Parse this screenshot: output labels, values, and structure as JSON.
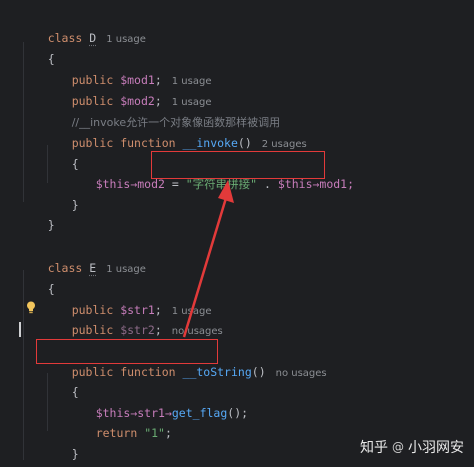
{
  "code": {
    "class_d": {
      "keyword": "class",
      "name": "D",
      "usage_hint": "1 usage",
      "open_brace": "{",
      "close_brace": "}",
      "mod1": {
        "keyword": "public",
        "var": "$mod1",
        "semi": ";",
        "hint": "1 usage"
      },
      "mod2": {
        "keyword": "public",
        "var": "$mod2",
        "semi": ";",
        "hint": "1 usage"
      },
      "comment": "//__invoke允许一个对象像函数那样被调用",
      "invoke": {
        "keyword1": "public",
        "keyword2": "function",
        "name": "__invoke",
        "parens": "()",
        "hint": "2 usages",
        "open_brace": "{",
        "close_brace": "}",
        "assign_lhs": "$this→mod2",
        "assign_op": " = ",
        "string": "\"字符串拼接\"",
        "concat": " . ",
        "rhs": "$this→mod1;"
      }
    },
    "class_e": {
      "keyword": "class",
      "name": "E",
      "usage_hint": "1 usage",
      "open_brace": "{",
      "close_brace": "}",
      "str1": {
        "keyword": "public",
        "var": "$str1",
        "semi": ";",
        "hint": "1 usage"
      },
      "str2": {
        "keyword": "public",
        "var": "$str2",
        "semi": ";",
        "hint": "no usages"
      },
      "tostring": {
        "keyword1": "public",
        "keyword2": "function",
        "name": "__toString",
        "parens": "()",
        "hint": "no usages",
        "open_brace": "{",
        "close_brace": "}",
        "call_lhs": "$this→str1→",
        "call_fn": "get_flag",
        "call_end": "();",
        "return_kw": "return",
        "return_val": "\"1\"",
        "return_semi": ";"
      }
    }
  },
  "watermark": {
    "site": "知乎",
    "separator": "@",
    "author": "小羽网安"
  },
  "colors": {
    "background": "#1e1f22",
    "annotation": "#e23a3a",
    "keyword": "#cf8e6d",
    "variable": "#c77dbb",
    "function": "#56a8f5",
    "string": "#6aab73"
  }
}
